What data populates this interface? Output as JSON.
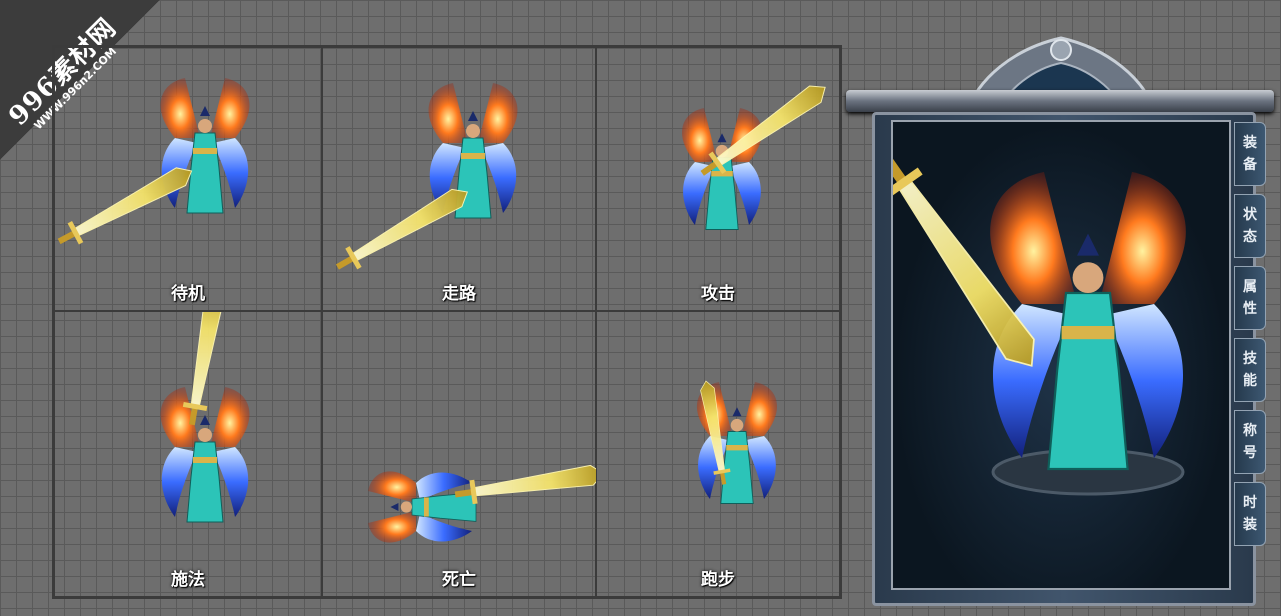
{
  "watermark": {
    "text": "996素材网",
    "url_text": "WWW.996n2.COM"
  },
  "actions": [
    {
      "label": "待机"
    },
    {
      "label": "走路"
    },
    {
      "label": "攻击"
    },
    {
      "label": "施法"
    },
    {
      "label": "死亡"
    },
    {
      "label": "跑步"
    }
  ],
  "panel": {
    "tabs": [
      {
        "label": "装备",
        "c1": "装",
        "c2": "备"
      },
      {
        "label": "状态",
        "c1": "状",
        "c2": "态"
      },
      {
        "label": "属性",
        "c1": "属",
        "c2": "性"
      },
      {
        "label": "技能",
        "c1": "技",
        "c2": "能"
      },
      {
        "label": "称号",
        "c1": "称",
        "c2": "号"
      },
      {
        "label": "时装",
        "c1": "时",
        "c2": "装"
      }
    ]
  },
  "colors": {
    "wing_fire": "#ff6a1a",
    "wing_ice": "#3a6cff",
    "armor": "#2cc4b8",
    "sword_glow": "#f4e36a"
  }
}
